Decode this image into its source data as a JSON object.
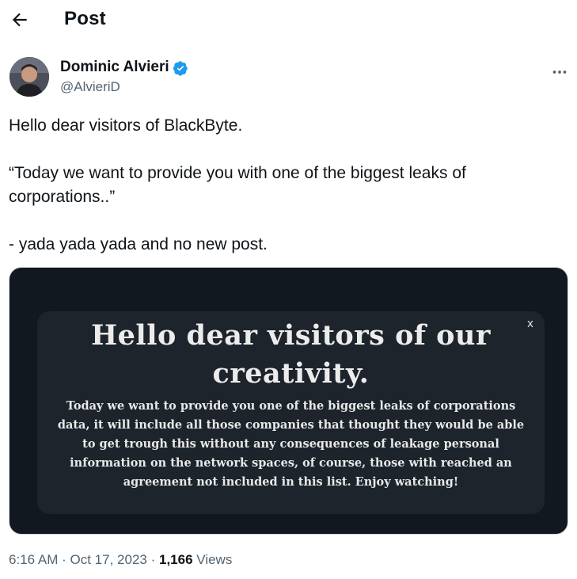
{
  "header": {
    "title": "Post",
    "back_icon": "arrow-left-icon"
  },
  "author": {
    "name": "Dominic Alvieri",
    "handle": "@AlvieriD",
    "verified_color": "#1d9bf0",
    "more_icon": "ellipsis-icon"
  },
  "tweet": {
    "text": "Hello dear visitors of BlackByte.\n\n“Today we want to provide you with one of the biggest leaks of corporations..”\n\n- yada yada yada and no new post."
  },
  "media": {
    "modal_close": "x",
    "title": "Hello dear visitors of our creativity.",
    "body": "Today we want to provide you one of the biggest leaks of corporations data, it will include all those companies that thought they would be able to get trough this without any consequences of leakage personal information on the network spaces, of course, those with reached an agreement not included in this list. Enjoy watching!"
  },
  "meta": {
    "time": "6:16 AM",
    "separator": "·",
    "date": "Oct 17, 2023",
    "views_count": "1,166",
    "views_label": "Views"
  }
}
